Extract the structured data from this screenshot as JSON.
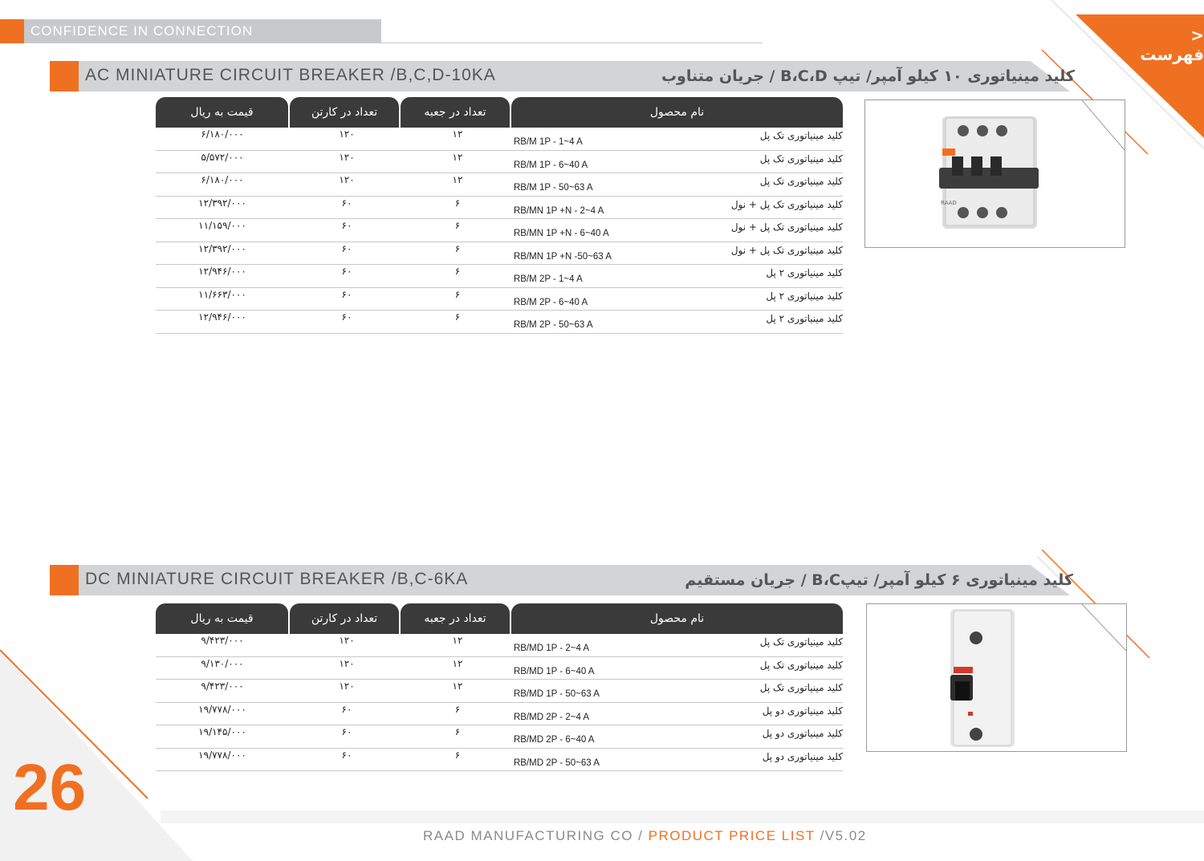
{
  "header": {
    "tagline": "CONFIDENCE IN CONNECTION",
    "index_link": "< فهرست"
  },
  "colors": {
    "accent": "#f07022",
    "header_gray": "#d3d4d6",
    "table_header": "#3a3a3a"
  },
  "ac_section": {
    "title_en": "AC MINIATURE CIRCUIT BREAKER /B,C,D-10KA",
    "title_fa": "کلید مینیاتوری ۱۰ کیلو آمپر/ تیپ B،C،D / جریان متناوب",
    "columns": {
      "price": "قیمت به ریال",
      "carton": "تعداد در کارتن",
      "box": "تعداد در جعبه",
      "name": "نام محصول"
    },
    "rows": [
      {
        "price": "۶/۱۸۰/۰۰۰",
        "carton": "۱۲۰",
        "box": "۱۲",
        "model": "RB/M  1P - 1~4 A",
        "name": "کلید مینیاتوری تک پل"
      },
      {
        "price": "۵/۵۷۲/۰۰۰",
        "carton": "۱۲۰",
        "box": "۱۲",
        "model": "RB/M  1P - 6~40 A",
        "name": "کلید مینیاتوری تک پل"
      },
      {
        "price": "۶/۱۸۰/۰۰۰",
        "carton": "۱۲۰",
        "box": "۱۲",
        "model": "RB/M  1P - 50~63 A",
        "name": "کلید مینیاتوری تک پل"
      },
      {
        "price": "۱۲/۳۹۲/۰۰۰",
        "carton": "۶۰",
        "box": "۶",
        "model": "RB/MN  1P +N - 2~4 A",
        "name": "کلید مینیاتوری تک پل + نول"
      },
      {
        "price": "۱۱/۱۵۹/۰۰۰",
        "carton": "۶۰",
        "box": "۶",
        "model": "RB/MN  1P +N - 6~40 A",
        "name": "کلید مینیاتوری تک پل + نول"
      },
      {
        "price": "۱۲/۳۹۲/۰۰۰",
        "carton": "۶۰",
        "box": "۶",
        "model": "RB/MN  1P +N -50~63 A",
        "name": "کلید مینیاتوری تک پل + نول"
      },
      {
        "price": "۱۲/۹۴۶/۰۰۰",
        "carton": "۶۰",
        "box": "۶",
        "model": "RB/M  2P - 1~4 A",
        "name": "کلید مینیاتوری ۲ پل"
      },
      {
        "price": "۱۱/۶۶۳/۰۰۰",
        "carton": "۶۰",
        "box": "۶",
        "model": "RB/M  2P - 6~40 A",
        "name": "کلید مینیاتوری ۲ پل"
      },
      {
        "price": "۱۲/۹۴۶/۰۰۰",
        "carton": "۶۰",
        "box": "۶",
        "model": "RB/M  2P - 50~63 A",
        "name": "کلید مینیاتوری ۲ پل"
      }
    ]
  },
  "dc_section": {
    "title_en": "DC MINIATURE CIRCUIT BREAKER /B,C-6KA",
    "title_fa": "کلید مینیاتوری ۶ کیلو آمپر/ تیپB،C / جریان مستقیم",
    "columns": {
      "price": "قیمت به ریال",
      "carton": "تعداد در کارتن",
      "box": "تعداد در جعبه",
      "name": "نام محصول"
    },
    "rows": [
      {
        "price": "۹/۴۲۳/۰۰۰",
        "carton": "۱۲۰",
        "box": "۱۲",
        "model": "RB/MD  1P - 2~4 A",
        "name": "کلید مینیاتوری تک پل"
      },
      {
        "price": "۹/۱۳۰/۰۰۰",
        "carton": "۱۲۰",
        "box": "۱۲",
        "model": "RB/MD  1P - 6~40 A",
        "name": "کلید مینیاتوری تک پل"
      },
      {
        "price": "۹/۴۲۳/۰۰۰",
        "carton": "۱۲۰",
        "box": "۱۲",
        "model": "RB/MD  1P - 50~63 A",
        "name": "کلید مینیاتوری تک پل"
      },
      {
        "price": "۱۹/۷۷۸/۰۰۰",
        "carton": "۶۰",
        "box": "۶",
        "model": "RB/MD 2P - 2~4 A",
        "name": "کلید مینیاتوری دو پل"
      },
      {
        "price": "۱۹/۱۴۵/۰۰۰",
        "carton": "۶۰",
        "box": "۶",
        "model": "RB/MD 2P - 6~40 A",
        "name": "کلید مینیاتوری دو پل"
      },
      {
        "price": "۱۹/۷۷۸/۰۰۰",
        "carton": "۶۰",
        "box": "۶",
        "model": "RB/MD 2P - 50~63 A",
        "name": "کلید مینیاتوری دو پل"
      }
    ]
  },
  "product_images": {
    "ac": "ac-breaker-3pole-icon",
    "dc": "dc-breaker-1pole-icon",
    "brand_mark": "RAAD"
  },
  "footer": {
    "page_number": "26",
    "company": "RAAD MANUFACTURING CO / ",
    "doc_title": "PRODUCT PRICE LIST",
    "version": " /V5.02"
  }
}
